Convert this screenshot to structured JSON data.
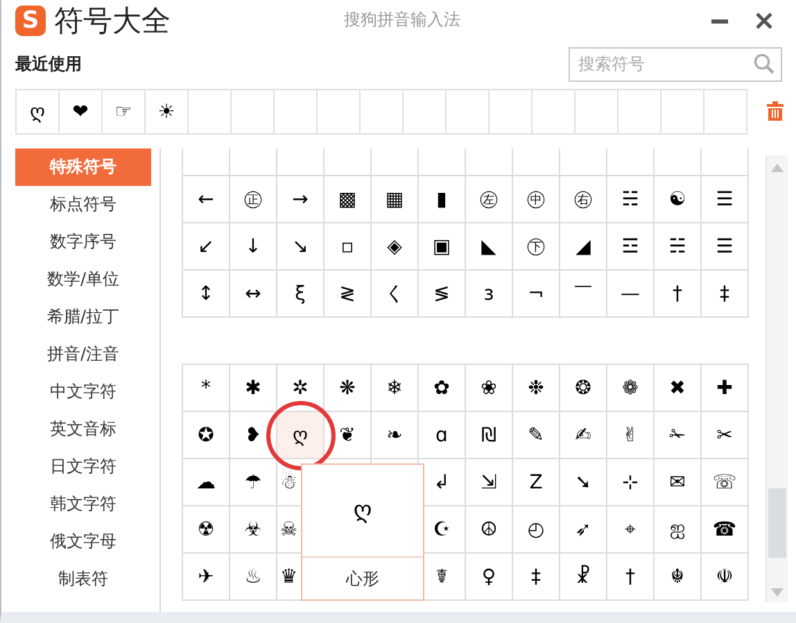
{
  "app": {
    "logo": "S",
    "title": "符号大全",
    "subtitle": "搜狗拼音输入法"
  },
  "recent": {
    "label": "最近使用",
    "search": {
      "placeholder": "搜索符号"
    },
    "symbols": [
      "ღ",
      "❤",
      "☞",
      "☀"
    ]
  },
  "categories": [
    {
      "label": "特殊符号",
      "selected": true
    },
    {
      "label": "标点符号",
      "selected": false
    },
    {
      "label": "数字序号",
      "selected": false
    },
    {
      "label": "数学/单位",
      "selected": false
    },
    {
      "label": "希腊/拉丁",
      "selected": false
    },
    {
      "label": "拼音/注音",
      "selected": false
    },
    {
      "label": "中文字符",
      "selected": false
    },
    {
      "label": "英文音标",
      "selected": false
    },
    {
      "label": "日文字符",
      "selected": false
    },
    {
      "label": "韩文字符",
      "selected": false
    },
    {
      "label": "俄文字母",
      "selected": false
    },
    {
      "label": "制表符",
      "selected": false
    }
  ],
  "grids": [
    {
      "rows": [
        [
          {
            "symbol": "←",
            "selected": false
          },
          {
            "symbol": "㊣",
            "selected": false
          },
          {
            "symbol": "→",
            "selected": false
          },
          {
            "symbol": "▩",
            "selected": false
          },
          {
            "symbol": "▦",
            "selected": false
          },
          {
            "symbol": "▮",
            "selected": false
          },
          {
            "symbol": "㊧",
            "selected": false
          },
          {
            "symbol": "㊥",
            "selected": false
          },
          {
            "symbol": "㊨",
            "selected": false
          },
          {
            "symbol": "☵",
            "selected": false
          },
          {
            "symbol": "☯",
            "selected": false
          },
          {
            "symbol": "☰",
            "selected": false
          }
        ],
        [
          {
            "symbol": "↙",
            "selected": false
          },
          {
            "symbol": "↓",
            "selected": false
          },
          {
            "symbol": "↘",
            "selected": false
          },
          {
            "symbol": "▫",
            "selected": false
          },
          {
            "symbol": "◈",
            "selected": false
          },
          {
            "symbol": "▣",
            "selected": false
          },
          {
            "symbol": "◣",
            "selected": false
          },
          {
            "symbol": "㊦",
            "selected": false
          },
          {
            "symbol": "◢",
            "selected": false
          },
          {
            "symbol": "☲",
            "selected": false
          },
          {
            "symbol": "☵",
            "selected": false
          },
          {
            "symbol": "☰",
            "selected": false
          }
        ],
        [
          {
            "symbol": "↕",
            "selected": false
          },
          {
            "symbol": "↔",
            "selected": false
          },
          {
            "symbol": "ξ",
            "selected": false
          },
          {
            "symbol": "≷",
            "selected": false
          },
          {
            "symbol": "く",
            "selected": false
          },
          {
            "symbol": "≶",
            "selected": false
          },
          {
            "symbol": "ɜ",
            "selected": false
          },
          {
            "symbol": "¬",
            "selected": false
          },
          {
            "symbol": "￣",
            "selected": false
          },
          {
            "symbol": "—",
            "selected": false
          },
          {
            "symbol": "†",
            "selected": false
          },
          {
            "symbol": "‡",
            "selected": false
          }
        ]
      ]
    },
    {
      "rows": [
        [
          {
            "symbol": "*",
            "selected": false
          },
          {
            "symbol": "✱",
            "selected": false
          },
          {
            "symbol": "✲",
            "selected": false
          },
          {
            "symbol": "❋",
            "selected": false
          },
          {
            "symbol": "❄",
            "selected": false
          },
          {
            "symbol": "✿",
            "selected": false
          },
          {
            "symbol": "❀",
            "selected": false
          },
          {
            "symbol": "❉",
            "selected": false
          },
          {
            "symbol": "❂",
            "selected": false
          },
          {
            "symbol": "❁",
            "selected": false
          },
          {
            "symbol": "✖",
            "selected": false
          },
          {
            "symbol": "✚",
            "selected": false
          }
        ],
        [
          {
            "symbol": "✪",
            "selected": false
          },
          {
            "symbol": "❥",
            "selected": false
          },
          {
            "symbol": "ღ",
            "selected": true
          },
          {
            "symbol": "❦",
            "selected": false
          },
          {
            "symbol": "❧",
            "selected": false
          },
          {
            "symbol": "ɑ",
            "selected": false
          },
          {
            "symbol": "₪",
            "selected": false
          },
          {
            "symbol": "✎",
            "selected": false
          },
          {
            "symbol": "✍",
            "selected": false
          },
          {
            "symbol": "✌",
            "selected": false
          },
          {
            "symbol": "✁",
            "selected": false
          },
          {
            "symbol": "✂",
            "selected": false
          }
        ],
        [
          {
            "symbol": "☁",
            "selected": false
          },
          {
            "symbol": "☂",
            "selected": false
          },
          {
            "symbol": "☃",
            "selected": false
          },
          null,
          null,
          {
            "symbol": "↲",
            "selected": false
          },
          {
            "symbol": "⇲",
            "selected": false
          },
          {
            "symbol": "Z",
            "selected": false
          },
          {
            "symbol": "➘",
            "selected": false
          },
          {
            "symbol": "⊹",
            "selected": false
          },
          {
            "symbol": "✉",
            "selected": false
          },
          {
            "symbol": "☏",
            "selected": false
          }
        ],
        [
          {
            "symbol": "☢",
            "selected": false
          },
          {
            "symbol": "☣",
            "selected": false
          },
          {
            "symbol": "☠",
            "selected": false
          },
          null,
          null,
          {
            "symbol": "☪",
            "selected": false
          },
          {
            "symbol": "☮",
            "selected": false
          },
          {
            "symbol": "◴",
            "selected": false
          },
          {
            "symbol": "➶",
            "selected": false
          },
          {
            "symbol": "⌖",
            "selected": false
          },
          {
            "symbol": "ஐ",
            "selected": false
          },
          {
            "symbol": "☎",
            "selected": false
          }
        ],
        [
          {
            "symbol": "✈",
            "selected": false
          },
          {
            "symbol": "♨",
            "selected": false
          },
          {
            "symbol": "♛",
            "selected": false
          },
          null,
          null,
          {
            "symbol": "☤",
            "selected": false
          },
          {
            "symbol": "♀",
            "selected": false
          },
          {
            "symbol": "‡",
            "selected": false
          },
          {
            "symbol": "☧",
            "selected": false
          },
          {
            "symbol": "†",
            "selected": false
          },
          {
            "symbol": "☬",
            "selected": false
          },
          {
            "symbol": "☫",
            "selected": false
          }
        ]
      ]
    }
  ],
  "preview": {
    "symbol": "ღ",
    "name": "心形"
  }
}
